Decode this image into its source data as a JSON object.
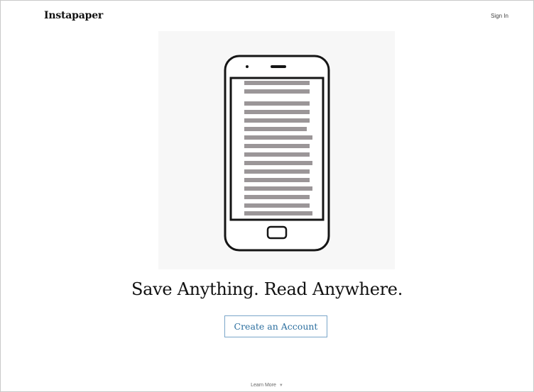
{
  "header": {
    "brand": "Instapaper",
    "signin_label": "Sign In"
  },
  "hero": {
    "illustration_icon": "phone-reading-icon",
    "tagline": "Save Anything. Read Anywhere.",
    "cta_label": "Create an Account"
  },
  "footer": {
    "learn_more_label": "Learn More",
    "learn_more_icon": "chevron-down-icon"
  },
  "colors": {
    "cta_border": "#7aa6c9",
    "cta_text": "#2c6f9f",
    "text_line": "#9b9698"
  }
}
